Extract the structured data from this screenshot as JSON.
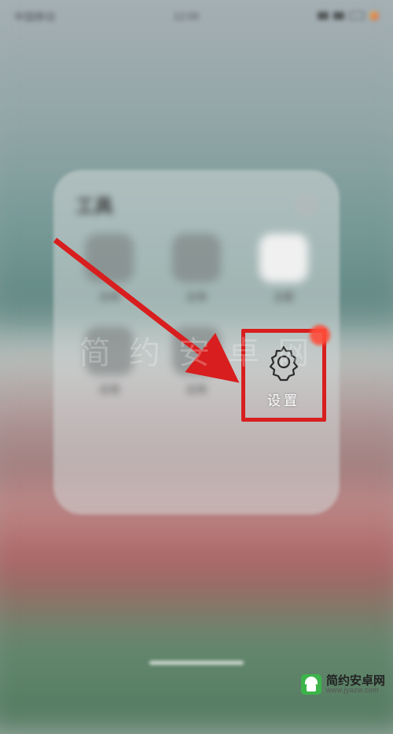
{
  "status": {
    "time": "12:00",
    "carrier": "中国移动"
  },
  "folder": {
    "title": "工具",
    "apps": [
      {
        "label": "应用"
      },
      {
        "label": "应用"
      },
      {
        "label": "主题"
      },
      {
        "label": "应用"
      },
      {
        "label": "应用"
      }
    ]
  },
  "highlighted_app": {
    "label": "设置",
    "icon_name": "gear-icon"
  },
  "annotation": {
    "type": "arrow",
    "color": "#d81e1e",
    "target": "settings-app"
  },
  "watermark": {
    "center": "简 约 安 卓 网",
    "brand": "简约安卓网",
    "url": "www.jyazw.com"
  }
}
